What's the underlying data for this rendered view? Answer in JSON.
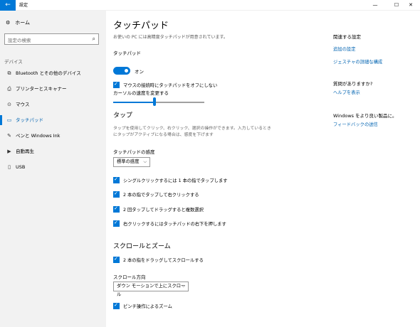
{
  "window": {
    "title": "設定",
    "back_glyph": "←",
    "minimize_glyph": "—",
    "maximize_glyph": "☐",
    "close_glyph": "✕"
  },
  "sidebar": {
    "home_label": "ホーム",
    "search_placeholder": "設定の検索",
    "section_label": "デバイス",
    "items": [
      {
        "label": "Bluetooth とその他のデバイス",
        "icon": "bluetooth-icon",
        "glyph": "⧉"
      },
      {
        "label": "プリンターとスキャナー",
        "icon": "printer-icon",
        "glyph": "⎙"
      },
      {
        "label": "マウス",
        "icon": "mouse-icon",
        "glyph": "⊙"
      },
      {
        "label": "タッチパッド",
        "icon": "touchpad-icon",
        "glyph": "▭",
        "active": true
      },
      {
        "label": "ペンと Windows Ink",
        "icon": "pen-icon",
        "glyph": "✎"
      },
      {
        "label": "自動再生",
        "icon": "autoplay-icon",
        "glyph": "▶"
      },
      {
        "label": "USB",
        "icon": "usb-icon",
        "glyph": "▯"
      }
    ]
  },
  "main": {
    "title": "タッチパッド",
    "description": "お使いの PC には高精度タッチパッドが用意されています。",
    "touchpad_label": "タッチパッド",
    "toggle_state": "オン",
    "mouse_disable_label": "マウスの接続時にタッチパッドをオフにしない",
    "cursor_speed_label": "カーソルの速度を変更する",
    "cursor_speed_value": 0.45,
    "tap_heading": "タップ",
    "tap_desc_line1": "タップを使用してクリック、右クリック、選択の操作ができます。入力しているとき",
    "tap_desc_line2": "にタップがアクティブになる場合は、感度を下げます",
    "sensitivity_label": "タッチパッドの感度",
    "sensitivity_value": "標準の感度",
    "tap_options": [
      "シングルクリックするには 1 本の指でタップします",
      "2 本の指でタップして右クリックする",
      "2 回タップしてドラッグすると複数選択",
      "右クリックするにはタッチパッドの右下を押します"
    ],
    "scroll_heading": "スクロールとズーム",
    "scroll_option": "2 本の指をドラッグしてスクロールする",
    "scroll_dir_label": "スクロール方向",
    "scroll_dir_value": "ダウン モーションで上にスクロール",
    "pinch_option": "ピンチ操作によるズーム"
  },
  "aside": {
    "related_heading": "関連する設定",
    "links1": [
      "追加の設定",
      "ジェスチャの詳細な構成"
    ],
    "question_heading": "質問がありますか?",
    "help_link": "ヘルプを表示",
    "improve_heading": "Windows をより良い製品に。",
    "feedback_link": "フィードバックの送信"
  },
  "colors": {
    "accent": "#0078d7",
    "link": "#0063b1",
    "sidebar_bg": "#f2f2f2"
  }
}
